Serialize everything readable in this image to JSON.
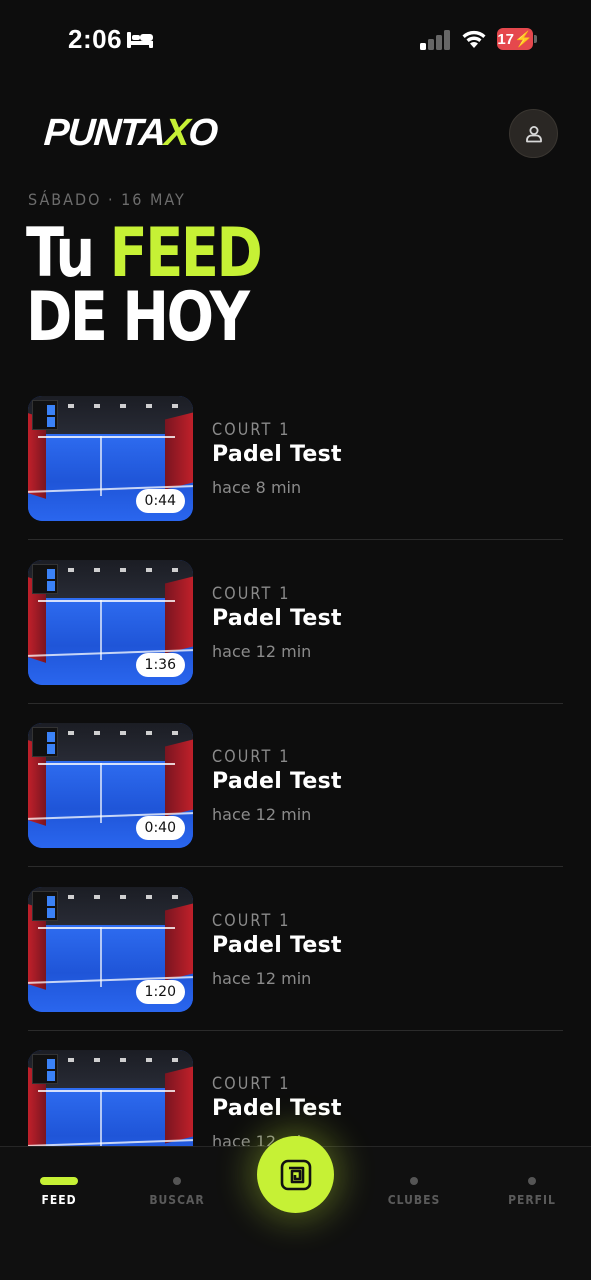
{
  "status_bar": {
    "time": "2:06",
    "battery": "17"
  },
  "header": {
    "logo_prefix": "PUNTA",
    "logo_x": "X",
    "logo_suffix": "O",
    "date": "SÁBADO · 16 MAY",
    "hero_line1_a": "Tu",
    "hero_line1_b": "FEED",
    "hero_line2": "DE HOY"
  },
  "feed": {
    "items": [
      {
        "court": "COURT 1",
        "title": "Padel Test",
        "time": "hace 8 min",
        "duration": "0:44"
      },
      {
        "court": "COURT 1",
        "title": "Padel Test",
        "time": "hace 12 min",
        "duration": "1:36"
      },
      {
        "court": "COURT 1",
        "title": "Padel Test",
        "time": "hace 12 min",
        "duration": "0:40"
      },
      {
        "court": "COURT 1",
        "title": "Padel Test",
        "time": "hace 12 min",
        "duration": "1:20"
      },
      {
        "court": "COURT 1",
        "title": "Padel Test",
        "time": "hace 12 min",
        "duration": ""
      }
    ]
  },
  "nav": {
    "feed": "FEED",
    "buscar": "BUSCAR",
    "clubes": "CLUBES",
    "perfil": "PERFIL",
    "active": "feed"
  },
  "colors": {
    "accent": "#c6f135",
    "background": "#0d0d0d",
    "battery_low": "#e5484d"
  },
  "icons": {
    "status_bed": "bed-icon",
    "status_signal": "cellular-signal-icon",
    "status_wifi": "wifi-icon",
    "profile": "user-icon",
    "center": "record-scan-icon"
  }
}
